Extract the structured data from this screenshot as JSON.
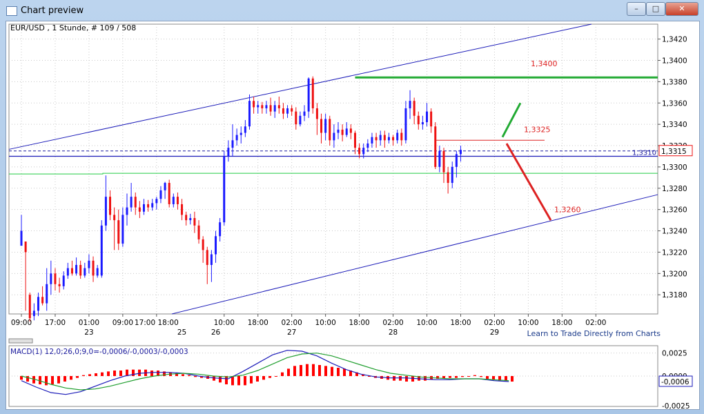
{
  "window": {
    "title": "Chart preview"
  },
  "window_buttons": {
    "minimize": "–",
    "maximize": "□",
    "close": "✕"
  },
  "link": {
    "label": "Learn to Trade Directly from Charts"
  },
  "chart_data": [
    {
      "type": "candlestick",
      "title": "EUR/USD , 1 Stunde, # 109 / 508",
      "ylim": [
        1.3162,
        1.3434
      ],
      "y_ticks": [
        "1,3420",
        "1,3400",
        "1,3380",
        "1,3360",
        "1,3340",
        "1,3320",
        "1,3300",
        "1,3280",
        "1,3260",
        "1,3240",
        "1,3220",
        "1,3200",
        "1,3180"
      ],
      "x_ticks": [
        {
          "label": "09:00",
          "x": -8
        },
        {
          "label": "17:00",
          "x": 0
        },
        {
          "label": "01:00",
          "x": 8
        },
        {
          "label": "09:00",
          "x": 16
        },
        {
          "label": "17:00 18:00",
          "x": 24
        },
        {
          "label": "10:00",
          "x": 40
        },
        {
          "label": "18:00",
          "x": 48
        },
        {
          "label": "02:00",
          "x": 56
        },
        {
          "label": "10:00",
          "x": 64
        },
        {
          "label": "18:00",
          "x": 72
        },
        {
          "label": "02:00",
          "x": 80
        },
        {
          "label": "10:00",
          "x": 88
        },
        {
          "label": "18:00",
          "x": 96
        },
        {
          "label": "02:00",
          "x": 104
        },
        {
          "label": "10:00",
          "x": 112
        },
        {
          "label": "18:00",
          "x": 120
        },
        {
          "label": "02:00",
          "x": 128
        }
      ],
      "date_labels": [
        {
          "label": "23",
          "x": 8
        },
        {
          "label": "25",
          "x": 30
        },
        {
          "label": "26",
          "x": 38
        },
        {
          "label": "27",
          "x": 56
        },
        {
          "label": "28",
          "x": 80
        },
        {
          "label": "29",
          "x": 104
        }
      ],
      "candles": [
        [
          1.3226,
          1.324,
          1.3255,
          1.3238
        ],
        [
          1.323,
          1.322,
          1.3226,
          1.3165
        ],
        [
          1.318,
          1.3158,
          1.3182,
          1.3155
        ],
        [
          1.316,
          1.3165,
          1.3172,
          1.3156
        ],
        [
          1.3165,
          1.3178,
          1.3182,
          1.316
        ],
        [
          1.3178,
          1.3172,
          1.3188,
          1.317
        ],
        [
          1.3172,
          1.319,
          1.3205,
          1.3165
        ],
        [
          1.319,
          1.32,
          1.3212,
          1.318
        ],
        [
          1.32,
          1.319,
          1.3205,
          1.3184
        ],
        [
          1.319,
          1.3188,
          1.3196,
          1.3182
        ],
        [
          1.3188,
          1.3198,
          1.3202,
          1.3185
        ],
        [
          1.3198,
          1.3205,
          1.321,
          1.3195
        ],
        [
          1.3205,
          1.32,
          1.3212,
          1.3198
        ],
        [
          1.32,
          1.3208,
          1.3215,
          1.3198
        ],
        [
          1.3208,
          1.3198,
          1.3212,
          1.3195
        ],
        [
          1.3198,
          1.3205,
          1.321,
          1.3196
        ],
        [
          1.3205,
          1.3212,
          1.3218,
          1.32
        ],
        [
          1.3212,
          1.3198,
          1.3216,
          1.3192
        ],
        [
          1.3198,
          1.3205,
          1.3208,
          1.3196
        ],
        [
          1.3198,
          1.3245,
          1.325,
          1.3196
        ],
        [
          1.3245,
          1.3272,
          1.3292,
          1.324
        ],
        [
          1.3272,
          1.3255,
          1.3278,
          1.325
        ],
        [
          1.3255,
          1.325,
          1.3262,
          1.3222
        ],
        [
          1.325,
          1.3228,
          1.326,
          1.3222
        ],
        [
          1.3228,
          1.3255,
          1.3262,
          1.3225
        ],
        [
          1.3255,
          1.3262,
          1.3275,
          1.3245
        ],
        [
          1.3262,
          1.3272,
          1.3285,
          1.3258
        ],
        [
          1.3272,
          1.3262,
          1.3276,
          1.3255
        ],
        [
          1.3262,
          1.3258,
          1.3268,
          1.3252
        ],
        [
          1.3258,
          1.3265,
          1.327,
          1.3255
        ],
        [
          1.3265,
          1.3262,
          1.3269,
          1.3258
        ],
        [
          1.3262,
          1.3266,
          1.327,
          1.3259
        ],
        [
          1.3266,
          1.327,
          1.3272,
          1.326
        ],
        [
          1.327,
          1.3278,
          1.3282,
          1.3266
        ],
        [
          1.3278,
          1.3285,
          1.3286,
          1.327
        ],
        [
          1.3285,
          1.3265,
          1.3288,
          1.3262
        ],
        [
          1.3265,
          1.3272,
          1.3275,
          1.3262
        ],
        [
          1.3272,
          1.3265,
          1.3276,
          1.326
        ],
        [
          1.3265,
          1.3255,
          1.327,
          1.325
        ],
        [
          1.3255,
          1.325,
          1.3258,
          1.3245
        ],
        [
          1.325,
          1.3252,
          1.3256,
          1.3246
        ],
        [
          1.3252,
          1.3245,
          1.3258,
          1.3238
        ],
        [
          1.3245,
          1.3232,
          1.325,
          1.3228
        ],
        [
          1.3232,
          1.3222,
          1.3235,
          1.321
        ],
        [
          1.3222,
          1.3208,
          1.3225,
          1.319
        ],
        [
          1.3208,
          1.3218,
          1.3222,
          1.3192
        ],
        [
          1.3218,
          1.3235,
          1.324,
          1.321
        ],
        [
          1.3235,
          1.3248,
          1.3252,
          1.323
        ],
        [
          1.3248,
          1.331,
          1.3315,
          1.3245
        ],
        [
          1.331,
          1.3318,
          1.3325,
          1.3305
        ],
        [
          1.3318,
          1.3325,
          1.334,
          1.331
        ],
        [
          1.3325,
          1.333,
          1.3336,
          1.332
        ],
        [
          1.333,
          1.3332,
          1.3338,
          1.3322
        ],
        [
          1.3332,
          1.3338,
          1.3344,
          1.3328
        ],
        [
          1.3338,
          1.3362,
          1.3368,
          1.3335
        ],
        [
          1.3362,
          1.3356,
          1.3366,
          1.335
        ],
        [
          1.3356,
          1.3358,
          1.3362,
          1.335
        ],
        [
          1.3358,
          1.3355,
          1.3361,
          1.335
        ],
        [
          1.3355,
          1.3358,
          1.3362,
          1.335
        ],
        [
          1.3358,
          1.3352,
          1.3365,
          1.3348
        ],
        [
          1.3352,
          1.3358,
          1.3362,
          1.3346
        ],
        [
          1.3358,
          1.3355,
          1.3366,
          1.335
        ],
        [
          1.3355,
          1.335,
          1.336,
          1.3345
        ],
        [
          1.335,
          1.3355,
          1.3358,
          1.3346
        ],
        [
          1.3355,
          1.3352,
          1.3358,
          1.3348
        ],
        [
          1.3352,
          1.334,
          1.3356,
          1.3335
        ],
        [
          1.334,
          1.3348,
          1.3352,
          1.3338
        ],
        [
          1.3348,
          1.3352,
          1.3358,
          1.3343
        ],
        [
          1.3352,
          1.3383,
          1.3384,
          1.3346
        ],
        [
          1.3383,
          1.3355,
          1.3385,
          1.335
        ],
        [
          1.3355,
          1.3345,
          1.336,
          1.333
        ],
        [
          1.3345,
          1.3332,
          1.335,
          1.3322
        ],
        [
          1.3332,
          1.3345,
          1.335,
          1.3325
        ],
        [
          1.3345,
          1.3325,
          1.3348,
          1.332
        ],
        [
          1.3325,
          1.3332,
          1.334,
          1.3318
        ],
        [
          1.3332,
          1.3335,
          1.3342,
          1.3326
        ],
        [
          1.3335,
          1.333,
          1.334,
          1.3324
        ],
        [
          1.333,
          1.3336,
          1.3342,
          1.3328
        ],
        [
          1.3336,
          1.3332,
          1.334,
          1.3326
        ],
        [
          1.3332,
          1.3318,
          1.3334,
          1.3312
        ],
        [
          1.3318,
          1.3312,
          1.3322,
          1.3308
        ],
        [
          1.3312,
          1.3318,
          1.3322,
          1.3308
        ],
        [
          1.3318,
          1.3322,
          1.3326,
          1.3314
        ],
        [
          1.3322,
          1.3328,
          1.3332,
          1.3318
        ],
        [
          1.3328,
          1.3325,
          1.3332,
          1.3318
        ],
        [
          1.3325,
          1.333,
          1.3334,
          1.332
        ],
        [
          1.333,
          1.3325,
          1.3334,
          1.3318
        ],
        [
          1.3325,
          1.3328,
          1.3332,
          1.3322
        ],
        [
          1.3328,
          1.3325,
          1.333,
          1.332
        ],
        [
          1.3325,
          1.3332,
          1.3335,
          1.3322
        ],
        [
          1.3332,
          1.3325,
          1.3336,
          1.332
        ],
        [
          1.3325,
          1.3355,
          1.3362,
          1.3322
        ],
        [
          1.3355,
          1.3362,
          1.3372,
          1.3345
        ],
        [
          1.3362,
          1.3348,
          1.3365,
          1.334
        ],
        [
          1.3348,
          1.334,
          1.3352,
          1.3335
        ],
        [
          1.334,
          1.3342,
          1.3348,
          1.3335
        ],
        [
          1.3342,
          1.3352,
          1.336,
          1.3338
        ],
        [
          1.3352,
          1.3338,
          1.3355,
          1.3332
        ],
        [
          1.3338,
          1.33,
          1.3342,
          1.3298
        ],
        [
          1.33,
          1.3315,
          1.332,
          1.3295
        ],
        [
          1.3315,
          1.3295,
          1.3318,
          1.3285
        ],
        [
          1.3295,
          1.3285,
          1.33,
          1.3275
        ],
        [
          1.3285,
          1.33,
          1.3305,
          1.328
        ],
        [
          1.33,
          1.3312,
          1.3315,
          1.329
        ],
        [
          1.3312,
          1.3316,
          1.332,
          1.3305
        ]
      ],
      "resistance_level": {
        "label": "1,3400",
        "value": 1.3384
      },
      "target_label": "1,3325",
      "lower_target_label": "1,3260",
      "hline_blue": {
        "label": "1,3310",
        "value": 1.331
      },
      "current_price": {
        "label": "1,3315",
        "value": 1.3315
      },
      "green_ma": {
        "value": 1.3294
      }
    },
    {
      "type": "line",
      "title": "MACD(1) 12,0;26,0;9,0=-0,0006/-0,0003/-0,0003",
      "ylim": [
        -0.0033,
        0.0033
      ],
      "y_ticks": [
        "0,0025",
        "0,0000"
      ],
      "current_label": "-0,0006",
      "bottom_tick": "-0,0025",
      "series": [
        {
          "key": "macd",
          "values": [
            -0.0005,
            -0.0012,
            -0.0018,
            -0.002,
            -0.0017,
            -0.0011,
            -0.0005,
            0.0,
            0.0003,
            0.0004,
            0.0004,
            0.0003,
            0.0,
            -0.0002,
            -0.0003,
            0.0005,
            0.0014,
            0.0023,
            0.0028,
            0.0027,
            0.0022,
            0.0014,
            0.0007,
            0.0002,
            -0.0001,
            -0.0002,
            -0.0002,
            -0.0003,
            -0.0004,
            -0.0004,
            -0.0003,
            -0.0003,
            -0.0005,
            -0.0006
          ]
        },
        {
          "key": "signal",
          "values": [
            0.0,
            -0.0004,
            -0.0009,
            -0.0013,
            -0.0015,
            -0.0014,
            -0.0011,
            -0.0007,
            -0.0003,
            0.0,
            0.0002,
            0.0003,
            0.0002,
            0.0,
            -0.0001,
            0.0001,
            0.0006,
            0.0013,
            0.002,
            0.0024,
            0.0025,
            0.0022,
            0.0017,
            0.0012,
            0.0007,
            0.0003,
            0.0001,
            -0.0001,
            -0.0002,
            -0.0003,
            -0.0003,
            -0.0003,
            -0.0004,
            -0.0005
          ]
        }
      ],
      "histogram": [
        -0.0004,
        -0.0006,
        -0.0008,
        -0.0009,
        -0.001,
        -0.0009,
        -0.0008,
        -0.0006,
        -0.0004,
        -0.0002,
        0.0001,
        0.0002,
        0.0003,
        0.0004,
        0.0005,
        0.0006,
        0.0006,
        0.0007,
        0.0007,
        0.0007,
        0.0007,
        0.0006,
        0.0006,
        0.0005,
        0.0004,
        0.0003,
        0.0002,
        0.0001,
        -0.0001,
        -0.0002,
        -0.0003,
        -0.0005,
        -0.0007,
        -0.0009,
        -0.001,
        -0.001,
        -0.001,
        -0.0008,
        -0.0006,
        -0.0004,
        -0.0002,
        0.0,
        0.0004,
        0.0008,
        0.0011,
        0.0012,
        0.0013,
        0.0013,
        0.0012,
        0.0011,
        0.001,
        0.0009,
        0.0008,
        0.0006,
        0.0004,
        0.0002,
        0.0,
        -0.0002,
        -0.0003,
        -0.0004,
        -0.0005,
        -0.0005,
        -0.0006,
        -0.0006,
        -0.0005,
        -0.0005,
        -0.0004,
        -0.0003,
        -0.0003,
        -0.0002,
        -0.0002,
        -0.0001,
        0.0,
        0.0001,
        -0.0001,
        -0.0003,
        -0.0004,
        -0.0005,
        -0.0005,
        -0.0006
      ],
      "colors": {
        "macd": "#1a1ab8",
        "signal": "#1f9e2e",
        "histogram": "#ff0000"
      }
    }
  ],
  "colors": {
    "bull": "#1a1aff",
    "bear": "#ee1111",
    "channel": "#1a1ab8",
    "green": "#22aa33",
    "red": "#dd2222"
  }
}
